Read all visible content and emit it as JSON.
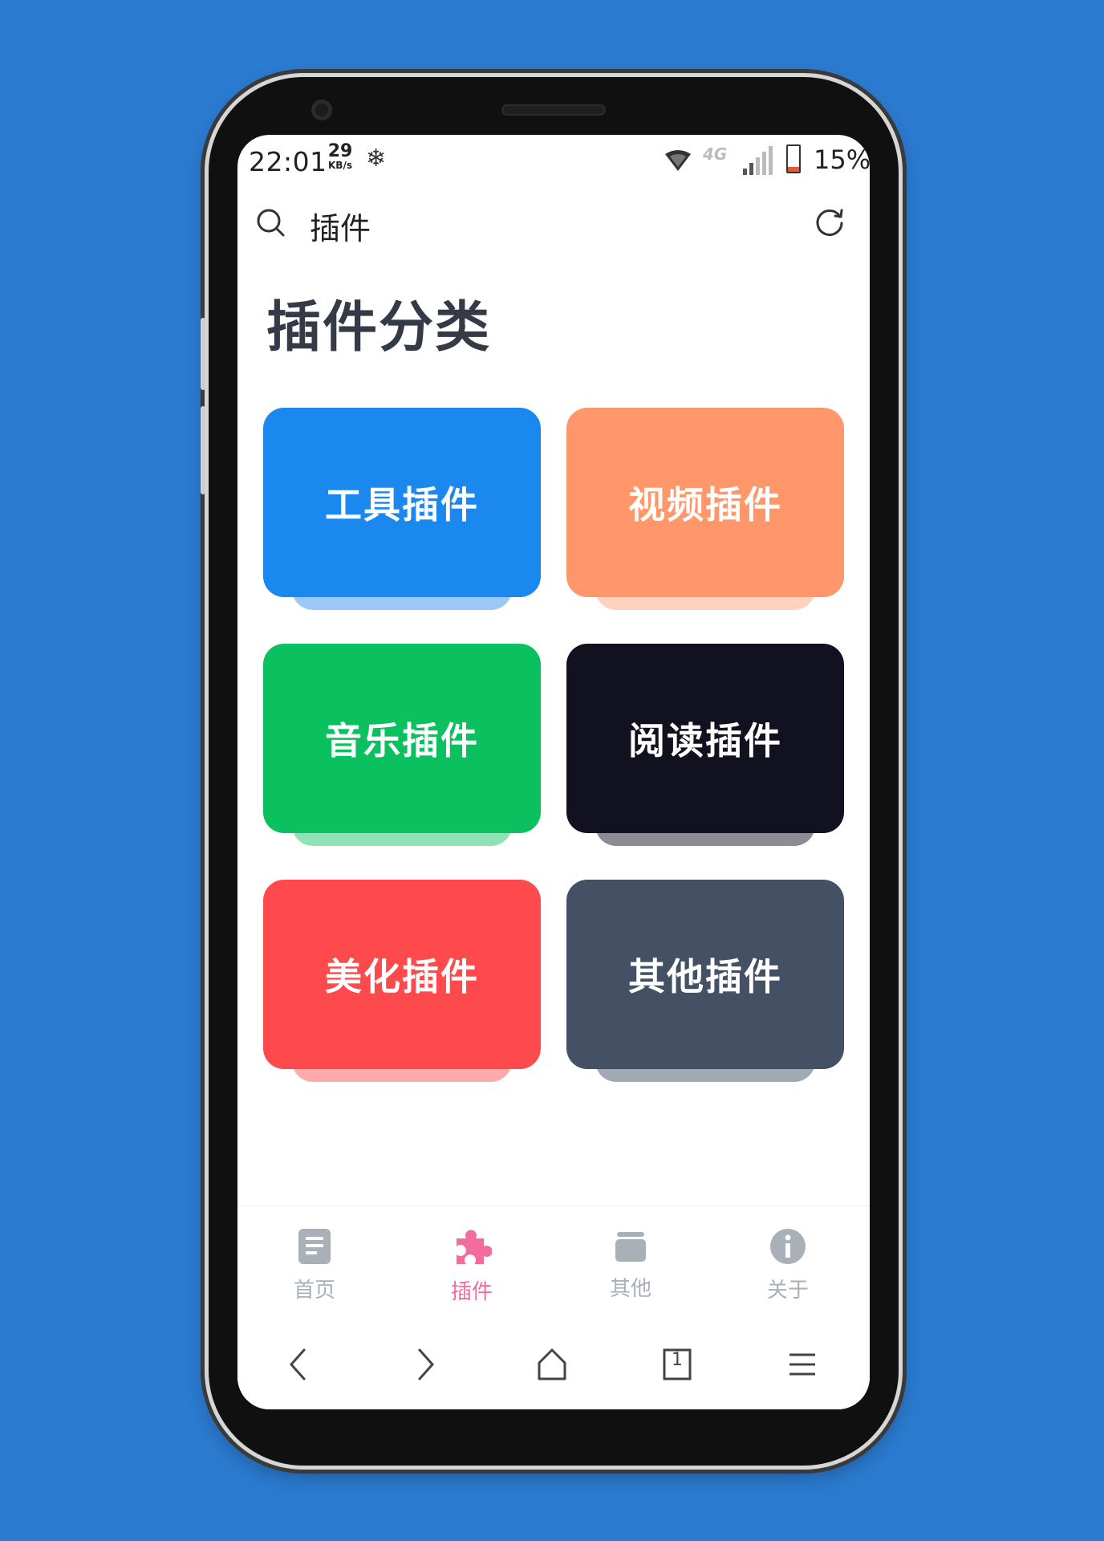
{
  "status_bar": {
    "time": "22:01",
    "speed_value": "29",
    "speed_unit": "KB/s",
    "network": "4G",
    "battery": "15%"
  },
  "search": {
    "query": "插件"
  },
  "page": {
    "title": "插件分类"
  },
  "categories": [
    {
      "label": "工具插件",
      "color": "#1b88f0",
      "shadow": "#9ac8f7"
    },
    {
      "label": "视频插件",
      "color": "#ff976a",
      "shadow": "#ffd2c0"
    },
    {
      "label": "音乐插件",
      "color": "#0bc15f",
      "shadow": "#8ee2b4"
    },
    {
      "label": "阅读插件",
      "color": "#12111f",
      "shadow": "#8b8c94"
    },
    {
      "label": "美化插件",
      "color": "#fe4a4d",
      "shadow": "#fdaaab"
    },
    {
      "label": "其他插件",
      "color": "#445165",
      "shadow": "#a1a9b4"
    }
  ],
  "tabs": [
    {
      "label": "首页",
      "icon": "document-icon",
      "active": false
    },
    {
      "label": "插件",
      "icon": "puzzle-icon",
      "active": true
    },
    {
      "label": "其他",
      "icon": "box-icon",
      "active": false
    },
    {
      "label": "关于",
      "icon": "info-icon",
      "active": false
    }
  ],
  "nav": {
    "tab_count": "1"
  },
  "colors": {
    "accent": "#f26c9e",
    "tab_inactive": "#aab0b7",
    "title": "#343a46"
  }
}
